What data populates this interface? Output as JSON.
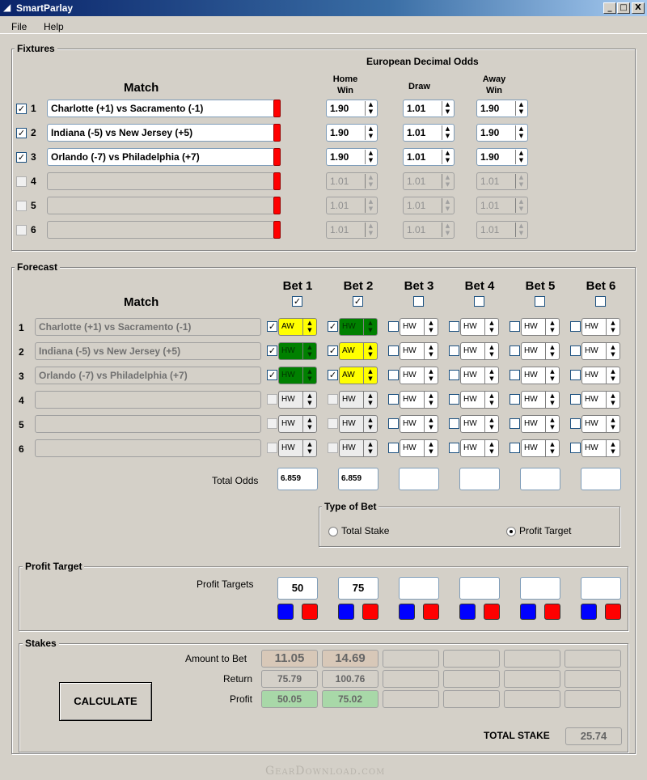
{
  "window": {
    "title": "SmartParlay",
    "buttons": [
      "_",
      "□",
      "X"
    ]
  },
  "menu": [
    "File",
    "Help"
  ],
  "fixtures": {
    "label": "Fixtures",
    "odds_header": "European Decimal Odds",
    "match_header": "Match",
    "col_home": [
      "Home",
      "Win"
    ],
    "col_draw": "Draw",
    "col_away": [
      "Away",
      "Win"
    ],
    "rows": [
      {
        "num": "1",
        "checked": true,
        "match": "Charlotte (+1) vs Sacramento (-1)",
        "home": "1.90",
        "draw": "1.01",
        "away": "1.90"
      },
      {
        "num": "2",
        "checked": true,
        "match": "Indiana (-5) vs New Jersey (+5)",
        "home": "1.90",
        "draw": "1.01",
        "away": "1.90"
      },
      {
        "num": "3",
        "checked": true,
        "match": "Orlando (-7) vs Philadelphia (+7)",
        "home": "1.90",
        "draw": "1.01",
        "away": "1.90"
      },
      {
        "num": "4",
        "checked": false,
        "match": "",
        "home": "1.01",
        "draw": "1.01",
        "away": "1.01"
      },
      {
        "num": "5",
        "checked": false,
        "match": "",
        "home": "1.01",
        "draw": "1.01",
        "away": "1.01"
      },
      {
        "num": "6",
        "checked": false,
        "match": "",
        "home": "1.01",
        "draw": "1.01",
        "away": "1.01"
      }
    ]
  },
  "forecast": {
    "label": "Forecast",
    "match_header": "Match",
    "bets": [
      {
        "label": "Bet 1",
        "checked": true
      },
      {
        "label": "Bet 2",
        "checked": true
      },
      {
        "label": "Bet 3",
        "checked": false
      },
      {
        "label": "Bet 4",
        "checked": false
      },
      {
        "label": "Bet 5",
        "checked": false
      },
      {
        "label": "Bet 6",
        "checked": false
      }
    ],
    "rows": [
      {
        "num": "1",
        "match": "Charlotte (+1) vs Sacramento (-1)",
        "picks": [
          [
            "AW",
            "yellow",
            true
          ],
          [
            "HW",
            "green",
            true
          ],
          [
            "HW",
            "",
            false
          ],
          [
            "HW",
            "",
            false
          ],
          [
            "HW",
            "",
            false
          ],
          [
            "HW",
            "",
            false
          ]
        ]
      },
      {
        "num": "2",
        "match": "Indiana (-5) vs New Jersey (+5)",
        "picks": [
          [
            "HW",
            "green",
            true
          ],
          [
            "AW",
            "yellow",
            true
          ],
          [
            "HW",
            "",
            false
          ],
          [
            "HW",
            "",
            false
          ],
          [
            "HW",
            "",
            false
          ],
          [
            "HW",
            "",
            false
          ]
        ]
      },
      {
        "num": "3",
        "match": "Orlando (-7) vs Philadelphia (+7)",
        "picks": [
          [
            "HW",
            "green",
            true
          ],
          [
            "AW",
            "yellow",
            true
          ],
          [
            "HW",
            "",
            false
          ],
          [
            "HW",
            "",
            false
          ],
          [
            "HW",
            "",
            false
          ],
          [
            "HW",
            "",
            false
          ]
        ]
      },
      {
        "num": "4",
        "match": "",
        "picks": [
          [
            "HW",
            "dis",
            false
          ],
          [
            "HW",
            "dis",
            false
          ],
          [
            "HW",
            "",
            false
          ],
          [
            "HW",
            "",
            false
          ],
          [
            "HW",
            "",
            false
          ],
          [
            "HW",
            "",
            false
          ]
        ]
      },
      {
        "num": "5",
        "match": "",
        "picks": [
          [
            "HW",
            "dis",
            false
          ],
          [
            "HW",
            "dis",
            false
          ],
          [
            "HW",
            "",
            false
          ],
          [
            "HW",
            "",
            false
          ],
          [
            "HW",
            "",
            false
          ],
          [
            "HW",
            "",
            false
          ]
        ]
      },
      {
        "num": "6",
        "match": "",
        "picks": [
          [
            "HW",
            "dis",
            false
          ],
          [
            "HW",
            "dis",
            false
          ],
          [
            "HW",
            "",
            false
          ],
          [
            "HW",
            "",
            false
          ],
          [
            "HW",
            "",
            false
          ],
          [
            "HW",
            "",
            false
          ]
        ]
      }
    ],
    "total_odds_label": "Total Odds",
    "total_odds": [
      "6.859",
      "6.859",
      "",
      "",
      "",
      ""
    ]
  },
  "type_of_bet": {
    "label": "Type of Bet",
    "options": [
      "Total Stake",
      "Profit Target"
    ],
    "selected": "Profit Target"
  },
  "profit_target": {
    "label": "Profit Target",
    "row_label": "Profit Targets",
    "values": [
      "50",
      "75",
      "",
      "",
      "",
      ""
    ]
  },
  "stakes": {
    "label": "Stakes",
    "amount_label": "Amount to Bet",
    "amounts": [
      "11.05",
      "14.69",
      "",
      "",
      "",
      ""
    ],
    "return_label": "Return",
    "returns": [
      "75.79",
      "100.76",
      "",
      "",
      "",
      ""
    ],
    "profit_label": "Profit",
    "profits": [
      "50.05",
      "75.02",
      "",
      "",
      "",
      ""
    ],
    "calculate": "CALCULATE",
    "total_label": "TOTAL STAKE",
    "total": "25.74",
    "colors": {
      "amount_bg": "#d8c8b8",
      "profit_bg": "#a8d8a8"
    }
  },
  "watermark": "GearDownload.com"
}
